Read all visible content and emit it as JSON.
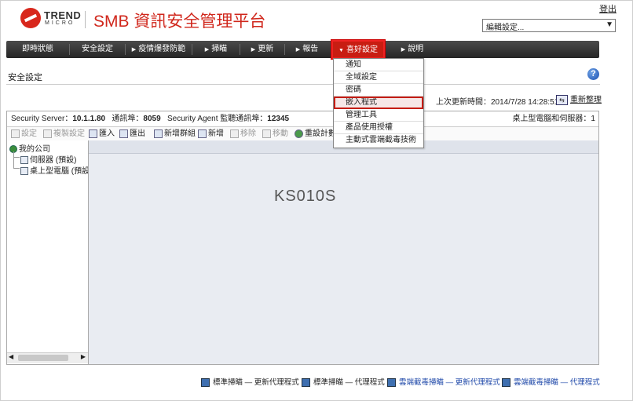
{
  "header": {
    "logo_line1": "TREND",
    "logo_line2": "MICRO",
    "app_title": "SMB 資訊安全管理平台",
    "logout_label": "登出",
    "edit_settings_select": "編輯設定..."
  },
  "nav": {
    "items": [
      {
        "label": "即時狀態"
      },
      {
        "label": "安全設定"
      },
      {
        "label": "疫情爆發防範",
        "arrow": "▶"
      },
      {
        "label": "掃瞄",
        "arrow": "▶"
      },
      {
        "label": "更新",
        "arrow": "▶"
      },
      {
        "label": "報告",
        "arrow": "▶"
      },
      {
        "label": "喜好設定",
        "arrow": "▼"
      },
      {
        "label": "說明",
        "arrow": "▶"
      }
    ]
  },
  "dropdown": {
    "items": [
      {
        "label": "通知"
      },
      {
        "label": "全域設定"
      },
      {
        "label": "密碼"
      },
      {
        "label": "嵌入程式"
      },
      {
        "label": "管理工具"
      },
      {
        "label": "產品使用授權"
      },
      {
        "label": "主動式雲端截毒技術"
      }
    ]
  },
  "page": {
    "title": "安全設定",
    "last_update": "上次更新時間：2014/7/28 14:28:51",
    "refresh_label": "重新整理"
  },
  "infobar": {
    "server_label": "Security Server：",
    "server_value": "10.1.1.80",
    "port_label": "通訊埠：",
    "port_value": "8059",
    "agent_label": "Security Agent 監聽通訊埠：",
    "agent_value": "12345",
    "right_text": "桌上型電腦和伺服器：1"
  },
  "toolbar": {
    "settings": "設定",
    "copy_settings": "複製設定",
    "import": "匯入",
    "export": "匯出",
    "new_group": "新增群組",
    "add": "新增",
    "remove": "移除",
    "move": "移動",
    "reset_counter": "重設計數"
  },
  "tree": {
    "root": "我的公司",
    "child1": "伺服器 (預設)",
    "child2": "桌上型電腦 (預設"
  },
  "watermark": "KS010S",
  "footer": {
    "link1": "標準掃瞄 — 更新代理程式",
    "link2": "標準掃瞄 — 代理程式",
    "link3": "雲端截毒掃瞄 — 更新代理程式",
    "link4": "雲端截毒掃瞄 — 代理程式"
  }
}
